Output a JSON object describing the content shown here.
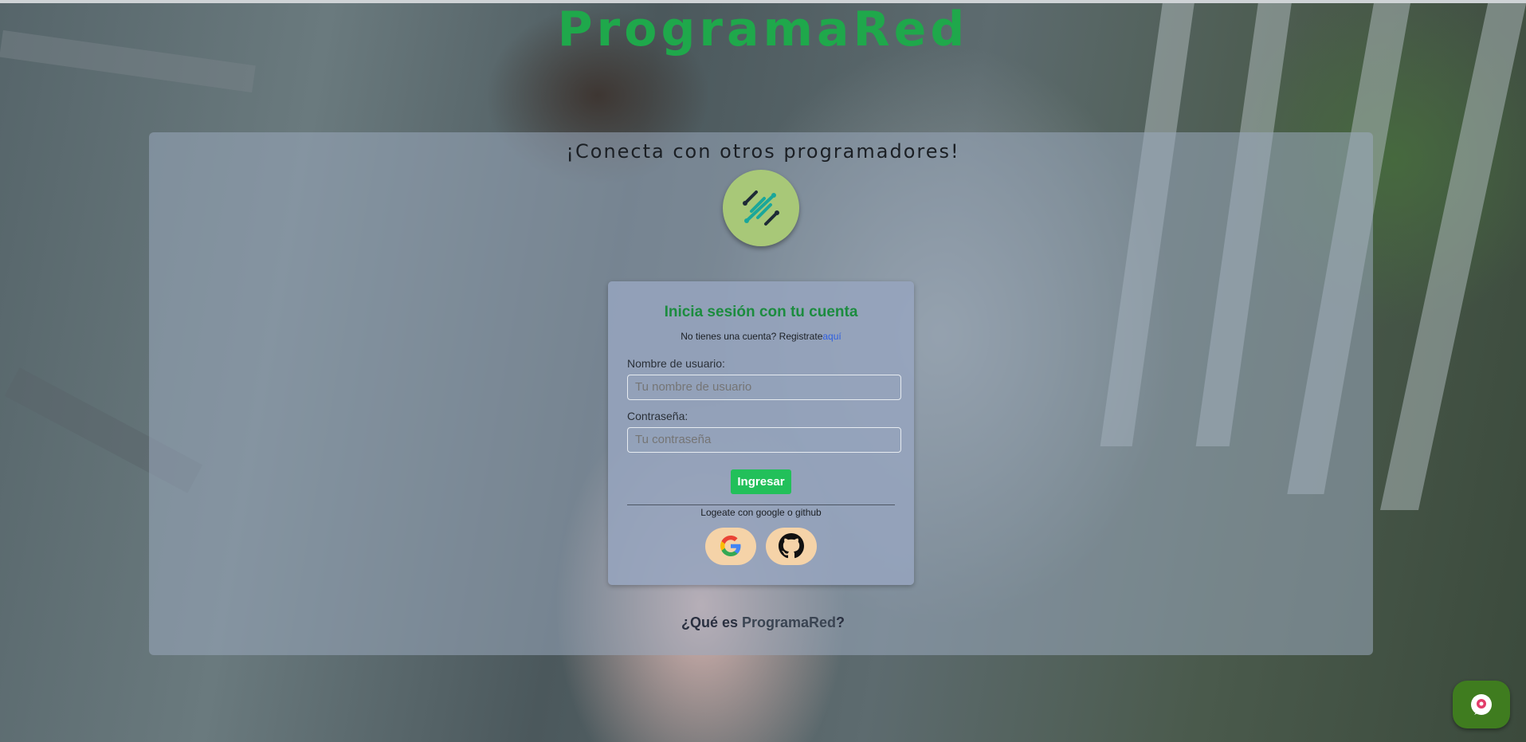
{
  "header": {
    "brand": "ProgramaRed"
  },
  "hero": {
    "tagline": "¡Conecta con otros programadores!"
  },
  "login": {
    "title": "Inicia sesión con tu cuenta",
    "register_prompt": "No tienes una cuenta? Registrate",
    "register_link": "aquí",
    "username_label": "Nombre de usuario:",
    "username_placeholder": "Tu nombre de usuario",
    "password_label": "Contraseña:",
    "password_placeholder": "Tu contraseña",
    "submit_label": "Ingresar",
    "social_text": "Logeate con google o github",
    "social_buttons": [
      {
        "icon": "google-icon"
      },
      {
        "icon": "github-icon"
      }
    ]
  },
  "footer": {
    "about_prefix": "¿Qué es ",
    "about_brand": "ProgramaRed",
    "about_suffix": "?"
  },
  "colors": {
    "brand_green": "#1fa84b",
    "button_green": "#22c05a",
    "social_bg": "#f5d3a8",
    "chat_green": "#3f7c1f",
    "link_blue": "#2f5fe0"
  },
  "chat_widget": {
    "icon": "chat-bot-icon"
  }
}
